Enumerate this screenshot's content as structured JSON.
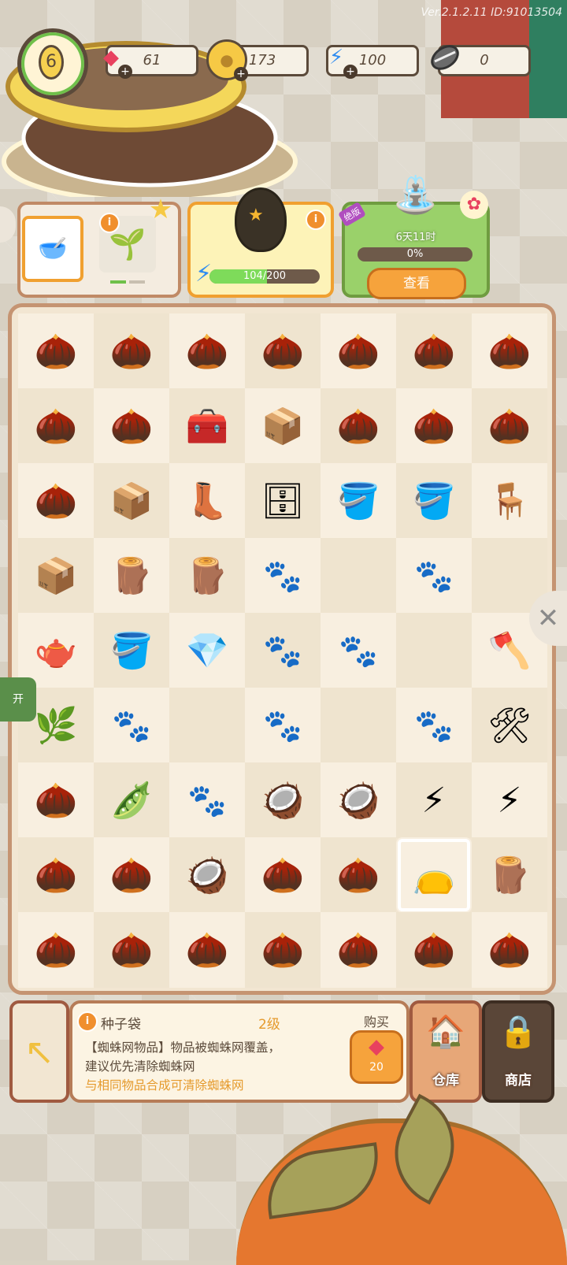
{
  "version": "Ver.2.1.2.11 ID:91013504",
  "level": "6",
  "currencies": [
    {
      "name": "gem",
      "icon": "gem-icon",
      "value": "61"
    },
    {
      "name": "coin",
      "icon": "coin-icon",
      "value": "173"
    },
    {
      "name": "energy",
      "icon": "lightning-icon",
      "value": "100"
    },
    {
      "name": "seed",
      "icon": "sunflower-seed-icon",
      "value": "0"
    }
  ],
  "egg_card": {
    "energy_text": "104/200",
    "energy_fraction": 0.52
  },
  "event_card": {
    "tag": "绝版",
    "timer": "6天11时",
    "progress": "0%",
    "button": "查看"
  },
  "board": {
    "rows": [
      [
        "acorn",
        "acorn",
        "acorn",
        "acorn",
        "acorn",
        "acorn",
        "acorn"
      ],
      [
        "acorn",
        "acorn",
        "toolbox",
        "crate",
        "acorn",
        "acorn",
        "acorn"
      ],
      [
        "acorn",
        "crate",
        "boots",
        "fridge",
        "pot",
        "pot",
        "table"
      ],
      [
        "crate",
        "plank",
        "plank",
        "paw",
        "empty",
        "paw",
        "empty"
      ],
      [
        "watering-can",
        "bucket",
        "gem-sack",
        "paw",
        "paw",
        "empty",
        "axe"
      ],
      [
        "sapling",
        "paw",
        "empty",
        "paw",
        "empty",
        "paw",
        "shovel"
      ],
      [
        "acorn",
        "seeds",
        "paw",
        "shell",
        "shell",
        "energy-pot",
        "energy-pot"
      ],
      [
        "acorn",
        "acorn",
        "shell",
        "acorn",
        "acorn",
        "seed-bag",
        "log"
      ],
      [
        "acorn",
        "acorn",
        "acorn",
        "acorn",
        "acorn",
        "acorn",
        "acorn"
      ]
    ],
    "selected": [
      7,
      5
    ]
  },
  "item_panel": {
    "title": "种子袋",
    "level": "2级",
    "buy_label": "购买",
    "desc": "【蜘蛛网物品】物品被蜘蛛网覆盖，建议优先清除蜘蛛网",
    "hint": "与相同物品合成可清除蜘蛛网",
    "price": "20"
  },
  "buttons": {
    "warehouse": "仓库",
    "shop": "商店",
    "side_left": "开"
  },
  "colors": {
    "board_bg": "#f2e6d2",
    "border": "#c59472",
    "accent": "#f6a33c"
  }
}
